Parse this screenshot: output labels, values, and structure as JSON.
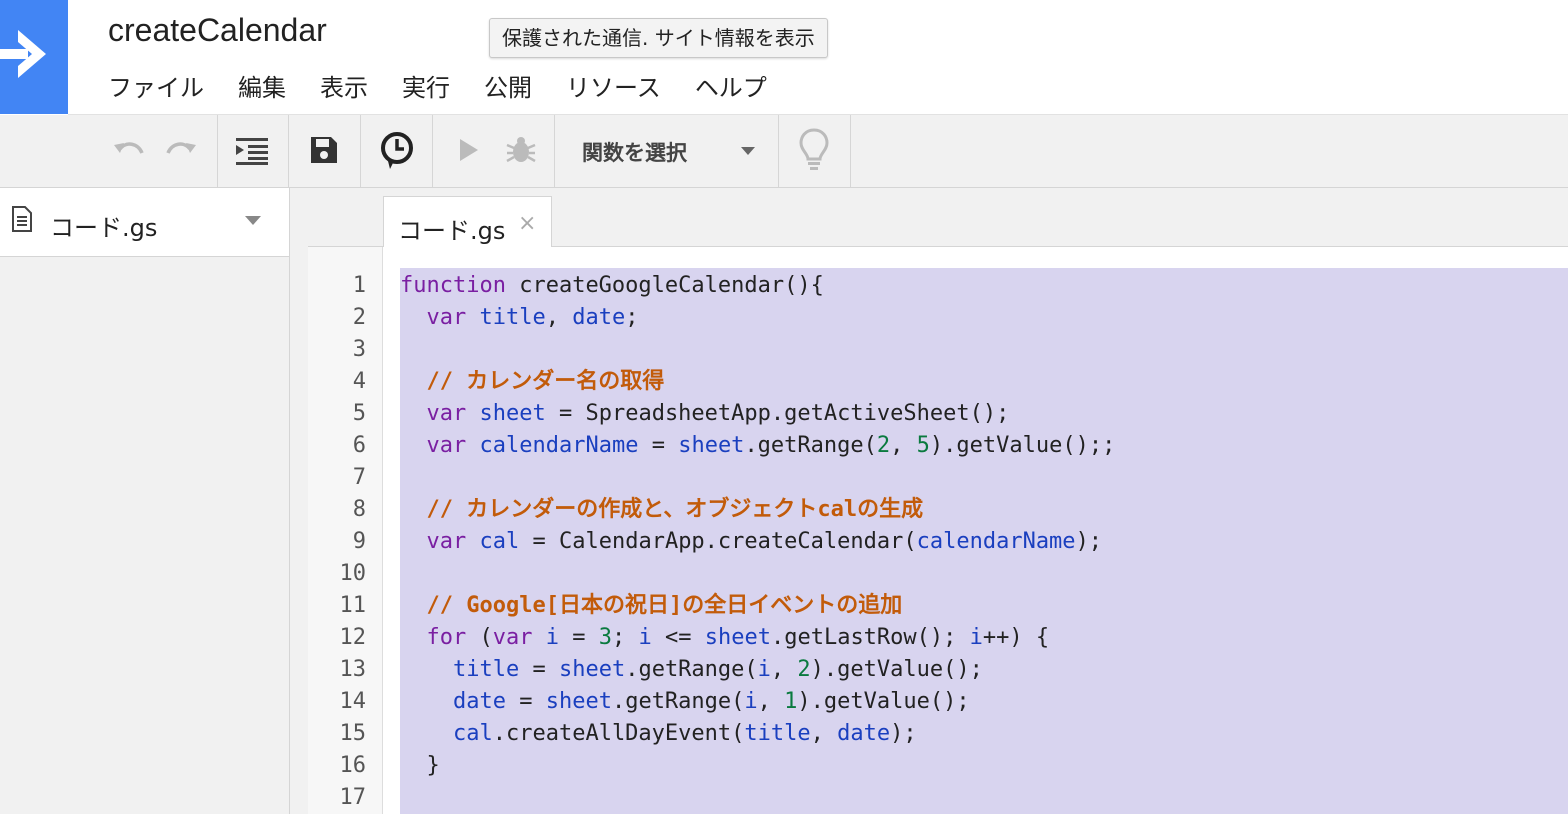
{
  "header": {
    "project_title": "createCalendar",
    "tooltip": "保護された通信. サイト情報を表示",
    "menu": [
      "ファイル",
      "編集",
      "表示",
      "実行",
      "公開",
      "リソース",
      "ヘルプ"
    ]
  },
  "toolbar": {
    "function_select": "関数を選択",
    "icons": [
      "undo-icon",
      "redo-icon",
      "indent-icon",
      "save-icon",
      "triggers-clock-icon",
      "run-icon",
      "debug-bug-icon",
      "lightbulb-icon"
    ]
  },
  "sidebar": {
    "file_name": "コード.gs"
  },
  "tab": {
    "label": "コード.gs",
    "close": "×"
  },
  "colors": {
    "accent": "#4285f4",
    "selection": "#d8d4ef",
    "keyword": "#7a1fa2",
    "variable": "#1a3fbf",
    "comment": "#c25b0a",
    "number": "#0a7a3f"
  },
  "code": {
    "line_numbers": [
      "1",
      "2",
      "3",
      "4",
      "5",
      "6",
      "7",
      "8",
      "9",
      "10",
      "11",
      "12",
      "13",
      "14",
      "15",
      "16",
      "17"
    ],
    "lines": [
      [
        {
          "t": "kw",
          "v": "function"
        },
        {
          "t": "",
          "v": " createGoogleCalendar(){"
        }
      ],
      [
        {
          "t": "",
          "v": "  "
        },
        {
          "t": "kw",
          "v": "var"
        },
        {
          "t": "",
          "v": " "
        },
        {
          "t": "vr",
          "v": "title"
        },
        {
          "t": "",
          "v": ", "
        },
        {
          "t": "vr",
          "v": "date"
        },
        {
          "t": "",
          "v": ";"
        }
      ],
      [],
      [
        {
          "t": "",
          "v": "  "
        },
        {
          "t": "cm",
          "v": "// カレンダー名の取得"
        }
      ],
      [
        {
          "t": "",
          "v": "  "
        },
        {
          "t": "kw",
          "v": "var"
        },
        {
          "t": "",
          "v": " "
        },
        {
          "t": "vr",
          "v": "sheet"
        },
        {
          "t": "",
          "v": " = SpreadsheetApp.getActiveSheet();"
        }
      ],
      [
        {
          "t": "",
          "v": "  "
        },
        {
          "t": "kw",
          "v": "var"
        },
        {
          "t": "",
          "v": " "
        },
        {
          "t": "vr",
          "v": "calendarName"
        },
        {
          "t": "",
          "v": " = "
        },
        {
          "t": "vr",
          "v": "sheet"
        },
        {
          "t": "",
          "v": ".getRange("
        },
        {
          "t": "nm",
          "v": "2"
        },
        {
          "t": "",
          "v": ", "
        },
        {
          "t": "nm",
          "v": "5"
        },
        {
          "t": "",
          "v": ").getValue();;"
        }
      ],
      [],
      [
        {
          "t": "",
          "v": "  "
        },
        {
          "t": "cm",
          "v": "// カレンダーの作成と、オブジェクトcalの生成"
        }
      ],
      [
        {
          "t": "",
          "v": "  "
        },
        {
          "t": "kw",
          "v": "var"
        },
        {
          "t": "",
          "v": " "
        },
        {
          "t": "vr",
          "v": "cal"
        },
        {
          "t": "",
          "v": " = CalendarApp.createCalendar("
        },
        {
          "t": "vr",
          "v": "calendarName"
        },
        {
          "t": "",
          "v": ");"
        }
      ],
      [],
      [
        {
          "t": "",
          "v": "  "
        },
        {
          "t": "cm",
          "v": "// Google[日本の祝日]の全日イベントの追加"
        }
      ],
      [
        {
          "t": "",
          "v": "  "
        },
        {
          "t": "kw",
          "v": "for"
        },
        {
          "t": "",
          "v": " ("
        },
        {
          "t": "kw",
          "v": "var"
        },
        {
          "t": "",
          "v": " "
        },
        {
          "t": "vr",
          "v": "i"
        },
        {
          "t": "",
          "v": " = "
        },
        {
          "t": "nm",
          "v": "3"
        },
        {
          "t": "",
          "v": "; "
        },
        {
          "t": "vr",
          "v": "i"
        },
        {
          "t": "",
          "v": " <= "
        },
        {
          "t": "vr",
          "v": "sheet"
        },
        {
          "t": "",
          "v": ".getLastRow(); "
        },
        {
          "t": "vr",
          "v": "i"
        },
        {
          "t": "",
          "v": "++) {"
        }
      ],
      [
        {
          "t": "",
          "v": "    "
        },
        {
          "t": "vr",
          "v": "title"
        },
        {
          "t": "",
          "v": " = "
        },
        {
          "t": "vr",
          "v": "sheet"
        },
        {
          "t": "",
          "v": ".getRange("
        },
        {
          "t": "vr",
          "v": "i"
        },
        {
          "t": "",
          "v": ", "
        },
        {
          "t": "nm",
          "v": "2"
        },
        {
          "t": "",
          "v": ").getValue();"
        }
      ],
      [
        {
          "t": "",
          "v": "    "
        },
        {
          "t": "vr",
          "v": "date"
        },
        {
          "t": "",
          "v": " = "
        },
        {
          "t": "vr",
          "v": "sheet"
        },
        {
          "t": "",
          "v": ".getRange("
        },
        {
          "t": "vr",
          "v": "i"
        },
        {
          "t": "",
          "v": ", "
        },
        {
          "t": "nm",
          "v": "1"
        },
        {
          "t": "",
          "v": ").getValue();"
        }
      ],
      [
        {
          "t": "",
          "v": "    "
        },
        {
          "t": "vr",
          "v": "cal"
        },
        {
          "t": "",
          "v": ".createAllDayEvent("
        },
        {
          "t": "vr",
          "v": "title"
        },
        {
          "t": "",
          "v": ", "
        },
        {
          "t": "vr",
          "v": "date"
        },
        {
          "t": "",
          "v": ");"
        }
      ],
      [
        {
          "t": "",
          "v": "  }"
        }
      ],
      []
    ]
  }
}
